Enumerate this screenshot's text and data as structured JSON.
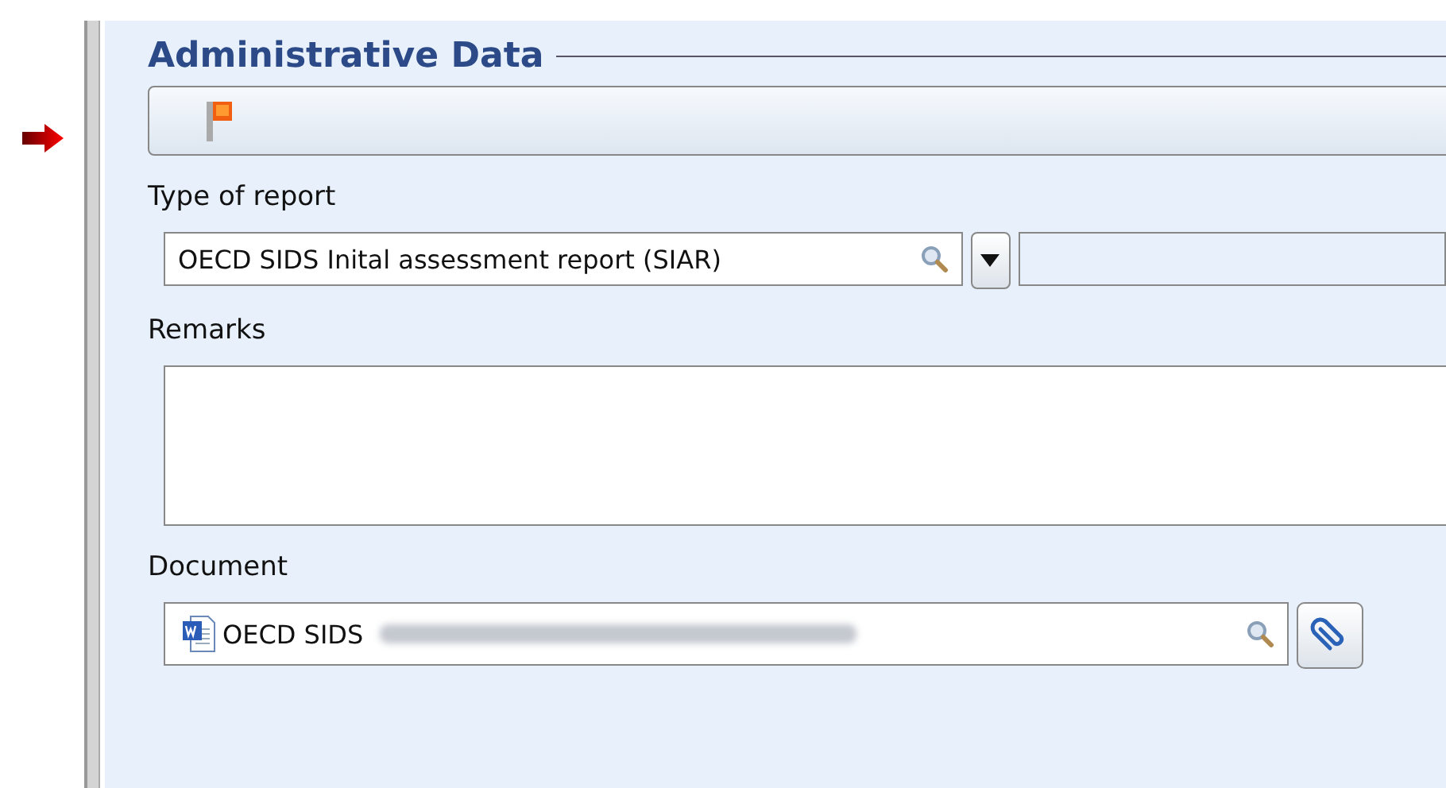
{
  "section": {
    "title": "Administrative Data"
  },
  "flag_bar": {
    "flagged": true
  },
  "type_of_report": {
    "label": "Type of report",
    "value": "OECD SIDS Inital assessment report (SIAR)"
  },
  "remarks": {
    "label": "Remarks"
  },
  "document": {
    "label": "Document",
    "value": "OECD SIDS",
    "blurred": true
  }
}
